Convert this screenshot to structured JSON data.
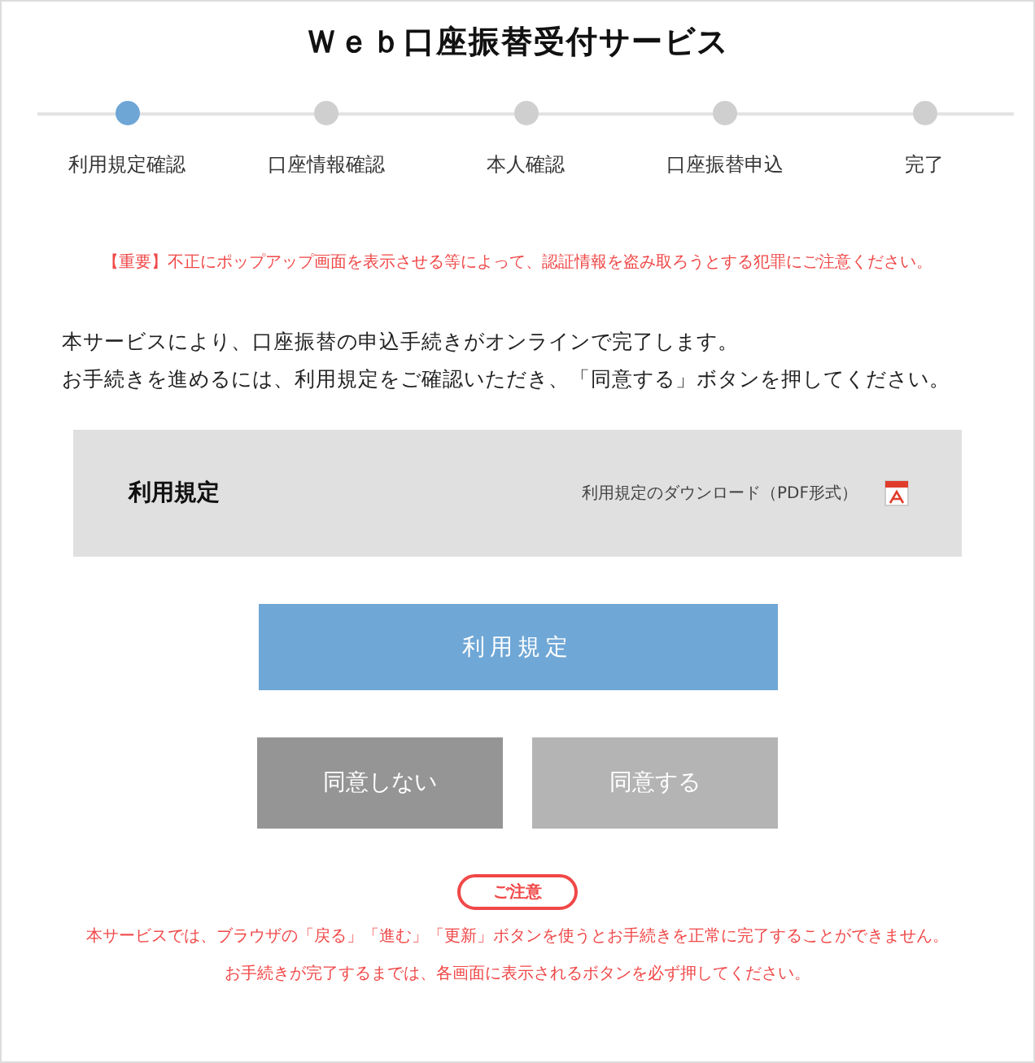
{
  "title": "Ｗｅｂ口座振替受付サービス",
  "steps": [
    {
      "label": "利用規定確認",
      "selected": true
    },
    {
      "label": "口座情報確認",
      "selected": false
    },
    {
      "label": "本人確認",
      "selected": false
    },
    {
      "label": "口座振替申込",
      "selected": false
    },
    {
      "label": "完了",
      "selected": false
    }
  ],
  "warning": "【重要】不正にポップアップ画面を表示させる等によって、認証情報を盗み取ろうとする犯罪にご注意ください。",
  "intro": [
    "本サービスにより、口座振替の申込手続きがオンラインで完了します。",
    "お手続きを進めるには、利用規定をご確認いただき、「同意する」ボタンを押してください。"
  ],
  "terms_panel": {
    "title": "利用規定",
    "download_link": "利用規定のダウンロード（PDF形式）"
  },
  "terms_button": "利用規定",
  "buttons": [
    {
      "label": "同意しない",
      "disabled": false
    },
    {
      "label": "同意する",
      "disabled": true
    }
  ],
  "notice": {
    "badge": "ご注意",
    "lines": [
      "本サービスでは、ブラウザの「戻る」「進む」「更新」ボタンを使うとお手続きを正常に完了することができません。",
      "お手続きが完了するまでは、各画面に表示されるボタンを必ず押してください。"
    ]
  }
}
